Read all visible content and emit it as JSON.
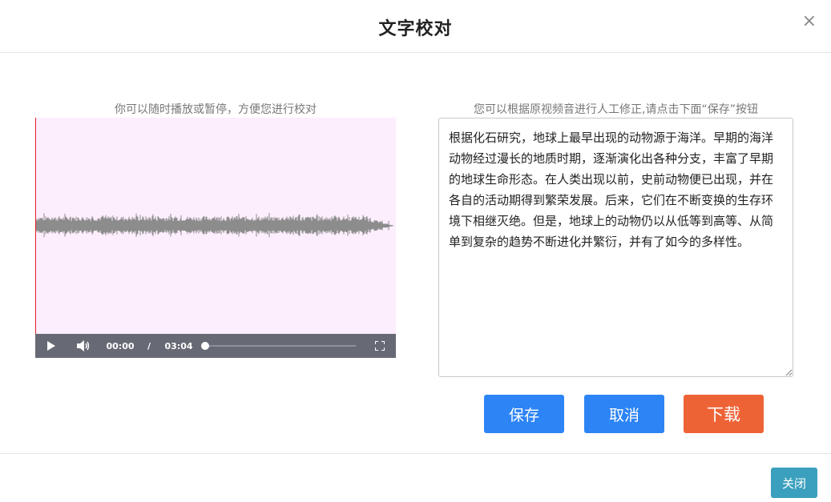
{
  "dialog": {
    "title": "文字校对",
    "close_glyph": "×"
  },
  "player": {
    "hint": "你可以随时播放或暂停，方便您进行校对",
    "current_time": "00:00",
    "time_separator": "/",
    "duration": "03:04",
    "progress": 0,
    "background_color": "#fdeefd",
    "waveform_color": "#8c8c8c",
    "cursor_color": "#e0202a",
    "icons": {
      "play": "play-icon",
      "volume": "volume-icon",
      "fullscreen": "fullscreen-icon"
    }
  },
  "editor": {
    "hint": "您可以根据原视频音进行人工修正,请点击下面“保存”按钮",
    "text": "根据化石研究，地球上最早出现的动物源于海洋。早期的海洋动物经过漫长的地质时期，逐渐演化出各种分支，丰富了早期的地球生命形态。在人类出现以前，史前动物便已出现，并在各自的活动期得到繁荣发展。后来，它们在不断变换的生存环境下相继灭绝。但是，地球上的动物仍以从低等到高等、从简单到复杂的趋势不断进化并繁衍，并有了如今的多样性。"
  },
  "actions": {
    "save_label": "保存",
    "cancel_label": "取消",
    "download_label": "下载",
    "save_color": "#2d84f5",
    "cancel_color": "#2d84f5",
    "download_color": "#ee6336"
  },
  "footer": {
    "close_label": "关闭",
    "close_color": "#3aa0bd"
  }
}
